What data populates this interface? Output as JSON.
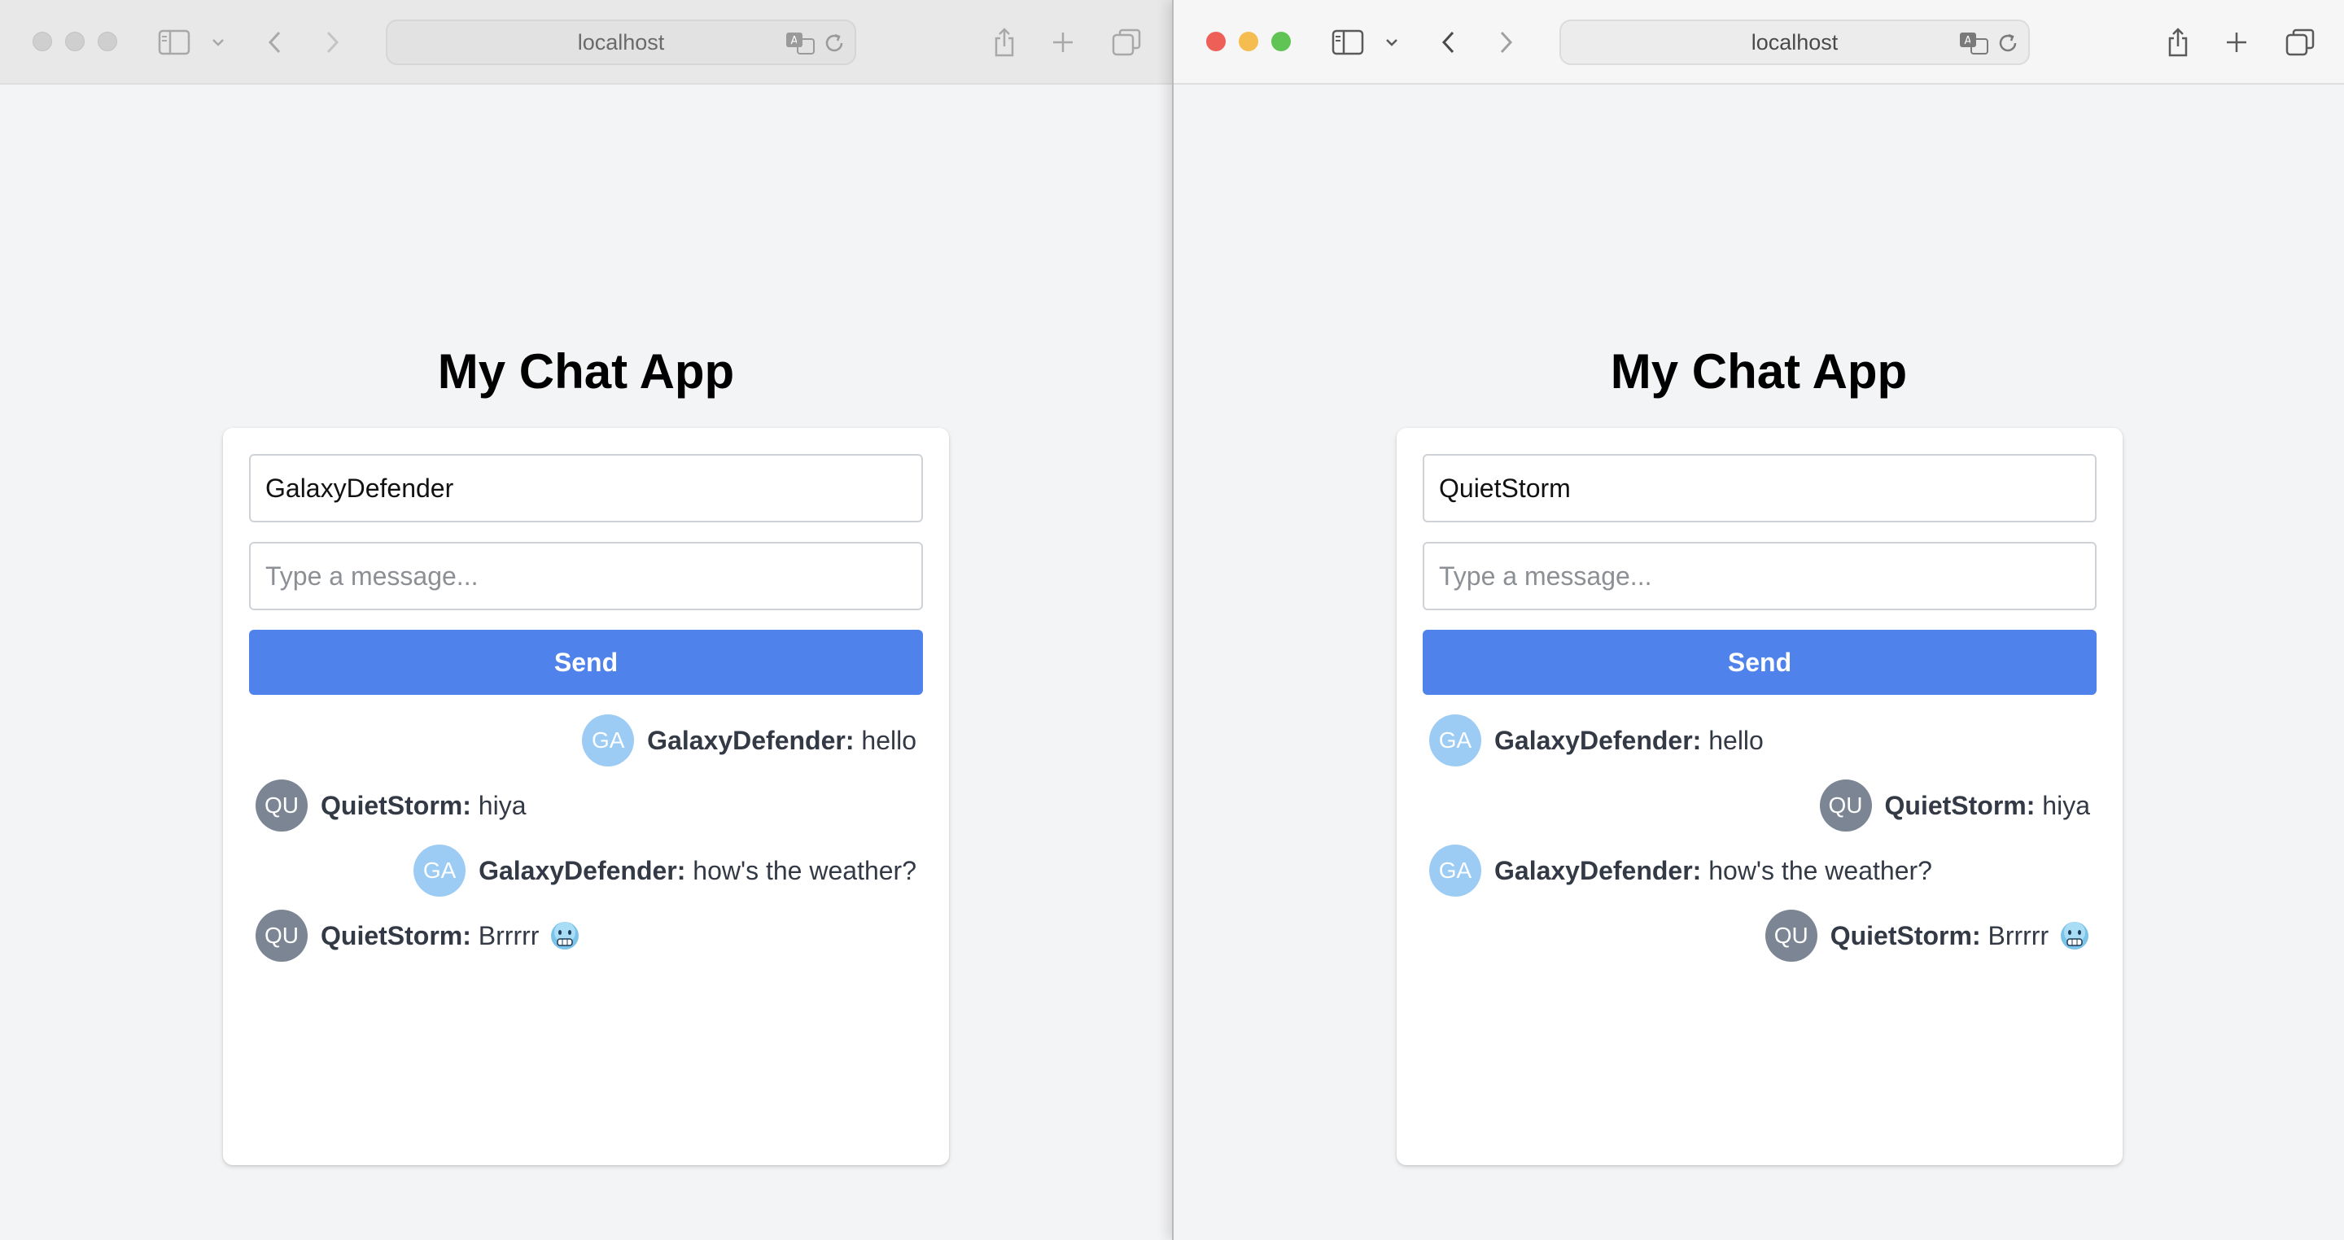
{
  "colors": {
    "send_button": "#4f82ea",
    "avatar_ga": "#9ccbf4",
    "avatar_qu": "#7b8594",
    "close_light": "#ee5f57",
    "minimize_light": "#f5bd4f",
    "zoom_light": "#5fc454",
    "inactive_light": "#cfcfcf"
  },
  "windows": [
    {
      "address": "localhost",
      "title": "My Chat App",
      "username": "GalaxyDefender",
      "message_placeholder": "Type a message...",
      "send_label": "Send",
      "messages": [
        {
          "avatar": "GA",
          "author": "GalaxyDefender:",
          "text": "hello",
          "align": "right"
        },
        {
          "avatar": "QU",
          "author": "QuietStorm:",
          "text": "hiya",
          "align": "left"
        },
        {
          "avatar": "GA",
          "author": "GalaxyDefender:",
          "text": "how's the weather?",
          "align": "right"
        },
        {
          "avatar": "QU",
          "author": "QuietStorm:",
          "text": "Brrrrr",
          "emoji": "freezing-face",
          "align": "left"
        }
      ]
    },
    {
      "address": "localhost",
      "title": "My Chat App",
      "username": "QuietStorm",
      "message_placeholder": "Type a message...",
      "send_label": "Send",
      "messages": [
        {
          "avatar": "GA",
          "author": "GalaxyDefender:",
          "text": "hello",
          "align": "left"
        },
        {
          "avatar": "QU",
          "author": "QuietStorm:",
          "text": "hiya",
          "align": "right"
        },
        {
          "avatar": "GA",
          "author": "GalaxyDefender:",
          "text": "how's the weather?",
          "align": "left"
        },
        {
          "avatar": "QU",
          "author": "QuietStorm:",
          "text": "Brrrrr",
          "emoji": "freezing-face",
          "align": "right"
        }
      ]
    }
  ]
}
